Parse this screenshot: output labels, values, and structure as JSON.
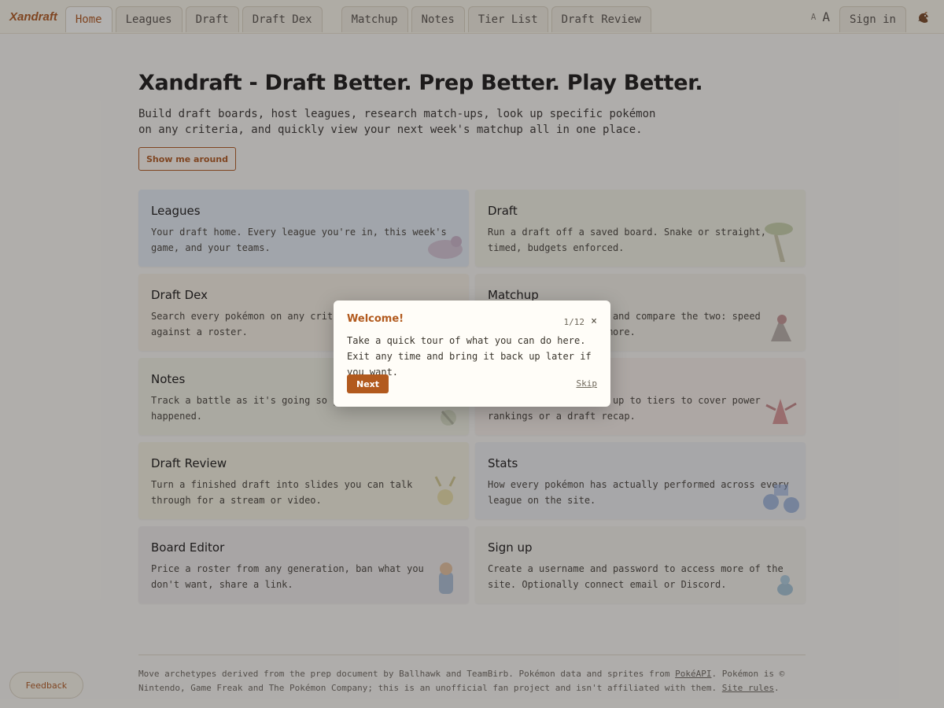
{
  "nav": {
    "brand": "Xandraft",
    "tabs": [
      "Home",
      "Leagues",
      "Draft",
      "Draft Dex"
    ],
    "tabs2": [
      "Matchup",
      "Notes",
      "Tier List",
      "Draft Review"
    ],
    "font_small": "A",
    "font_big": "A",
    "signin": "Sign in"
  },
  "hero": {
    "title": "Xandraft - Draft Better. Prep Better. Play Better.",
    "description": "Build draft boards, host leagues, research match-ups, look up specific pokémon on any criteria, and quickly view your next week's matchup all in one place.",
    "tour_button": "Show me around"
  },
  "cards": [
    {
      "title": "Leagues",
      "desc": "Your draft home. Every league you're in, this week's game, and your teams.",
      "bg": "#e6ecef"
    },
    {
      "title": "Draft",
      "desc": "Run a draft off a saved board. Snake or straight, timed, budgets enforced.",
      "bg": "#f3f1e0"
    },
    {
      "title": "Draft Dex",
      "desc": "Search every pokémon on any criteria and compare it against a roster.",
      "bg": "#f8f0df"
    },
    {
      "title": "Matchup",
      "desc": "Line up any two teams and compare the two: speed tiers, coverage, and more.",
      "bg": "#f5f0e2"
    },
    {
      "title": "Notes",
      "desc": "Track a battle as it's going so you don't lose what happened.",
      "bg": "#f3f1e0"
    },
    {
      "title": "Tier List",
      "desc": "Build tier lists with up to tiers to cover power rankings or a draft recap.",
      "bg": "#f8eee4"
    },
    {
      "title": "Draft Review",
      "desc": "Turn a finished draft into slides you can talk through for a stream or video.",
      "bg": "#f6f2dc"
    },
    {
      "title": "Stats",
      "desc": "How every pokémon has actually performed across every league on the site.",
      "bg": "#eeeeec"
    },
    {
      "title": "Board Editor",
      "desc": "Price a roster from any generation, ban what you don't want, share a link.",
      "bg": "#f0ece6"
    },
    {
      "title": "Sign up",
      "desc": "Create a username and password to access more of the site. Optionally connect email or Discord.",
      "bg": "#f5f1e6"
    }
  ],
  "footer": {
    "text1": "Move archetypes derived from the prep document by Ballhawk and TeamBirb. Pokémon data and sprites from ",
    "link1": "PokéAPI",
    "text2": ". Pokémon is © Nintendo, Game Freak and The Pokémon Company; this is an unofficial fan project and isn't affiliated with them. ",
    "link2": "Site rules",
    "text3": "."
  },
  "feedback": "Feedback",
  "modal": {
    "title": "Welcome!",
    "step": "1/12",
    "close": "×",
    "body": "Take a quick tour of what you can do here. Exit any time and bring it back up later if you want.",
    "next": "Next",
    "skip": "Skip"
  },
  "colors": {
    "accent": "#b25a1e",
    "background": "#fbf8ef"
  }
}
